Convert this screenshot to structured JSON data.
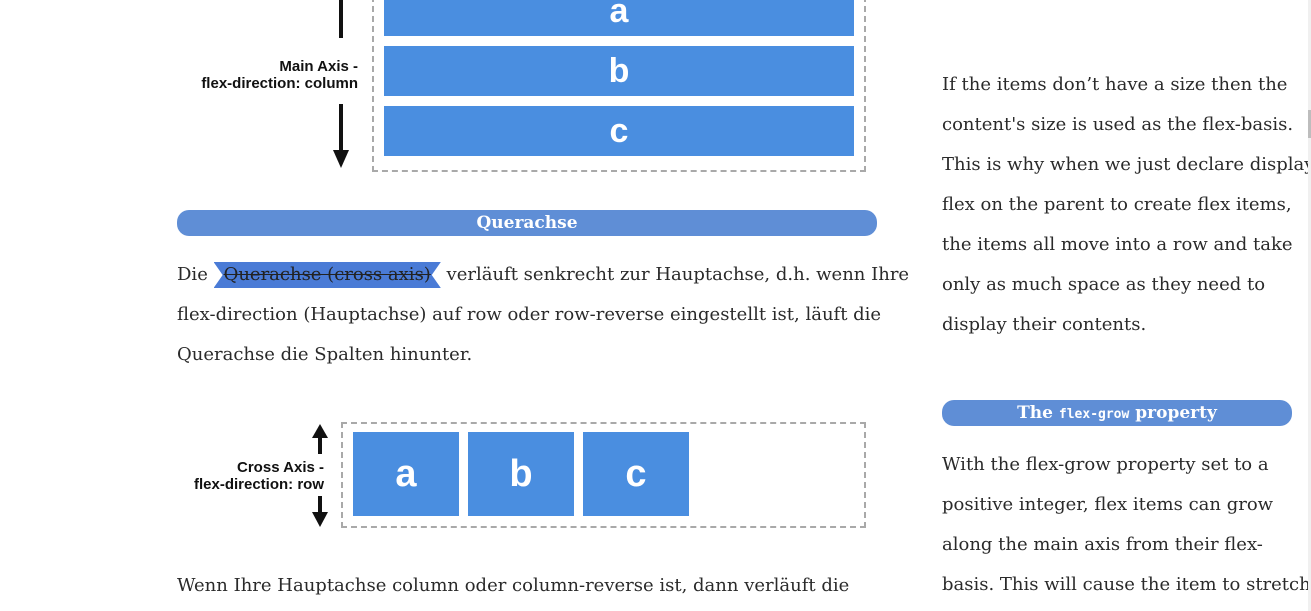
{
  "diagram_column": {
    "items": [
      "a",
      "b",
      "c"
    ],
    "axis_label_line1": "Main Axis -",
    "axis_label_line2": "flex-direction: column"
  },
  "heading_querachse": "Querachse",
  "paragraph_querachse": {
    "prefix": "Die ",
    "highlight": "Querachse (cross axis)",
    "rest_line1": " verläuft senkrecht zur Hauptachse, d.h. wenn Ihre",
    "line2": "flex-direction (Hauptachse) auf row oder row-reverse eingestellt ist, läuft die",
    "line3": "Querachse die Spalten hinunter."
  },
  "diagram_row": {
    "items": [
      "a",
      "b",
      "c"
    ],
    "axis_label_line1": "Cross Axis -",
    "axis_label_line2": "flex-direction: row"
  },
  "paragraph_bottom": "Wenn Ihre Hauptachse column oder column-reverse ist, dann verläuft die",
  "sidebar": {
    "para1_lines": [
      "If the items don’t have a size then the",
      "content's size is used as the flex-basis.",
      "This is why when we just declare display:",
      "flex on the parent to create flex items,",
      "the items all move into a row and take",
      "only as much space as they need to",
      "display their contents."
    ],
    "heading_prefix": "The ",
    "heading_code": "flex-grow",
    "heading_suffix": " property",
    "para2_lines": [
      "With the flex-grow property set to a",
      "positive integer, flex items can grow",
      "along the main axis from their flex-",
      "basis. This will cause the item to stretch"
    ]
  }
}
